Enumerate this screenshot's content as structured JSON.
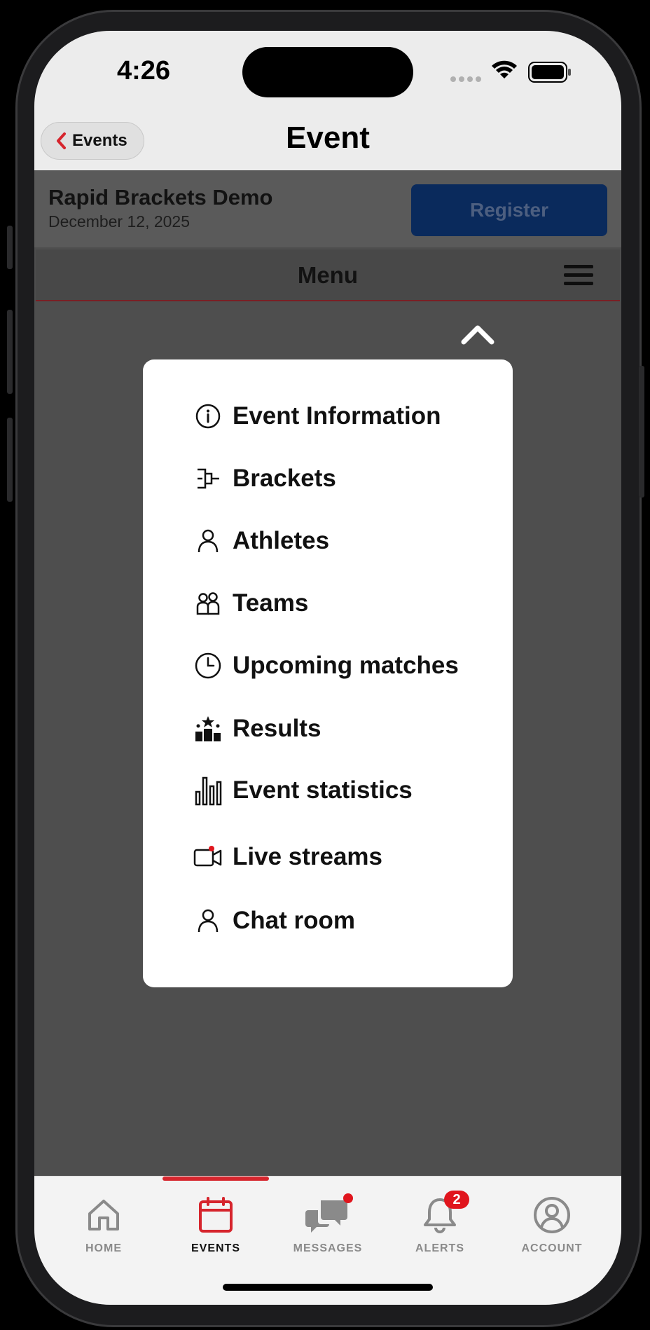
{
  "status_bar": {
    "time": "4:26"
  },
  "nav": {
    "back_label": "Events",
    "title": "Event"
  },
  "event": {
    "name": "Rapid Brackets Demo",
    "date": "December 12, 2025",
    "register_label": "Register",
    "menu_label": "Menu"
  },
  "popup_menu": {
    "items": [
      {
        "label": "Event Information",
        "icon": "info-icon"
      },
      {
        "label": "Brackets",
        "icon": "bracket-icon"
      },
      {
        "label": "Athletes",
        "icon": "person-icon"
      },
      {
        "label": "Teams",
        "icon": "team-icon"
      },
      {
        "label": "Upcoming matches",
        "icon": "clock-icon"
      },
      {
        "label": "Results",
        "icon": "podium-icon"
      },
      {
        "label": "Event statistics",
        "icon": "bar-chart-icon"
      },
      {
        "label": "Live streams",
        "icon": "video-camera-icon"
      },
      {
        "label": "Chat room",
        "icon": "person-icon"
      }
    ]
  },
  "tab_bar": {
    "active": "EVENTS",
    "tabs": [
      {
        "label": "HOME",
        "icon": "home-icon"
      },
      {
        "label": "EVENTS",
        "icon": "calendar-icon"
      },
      {
        "label": "MESSAGES",
        "icon": "chat-bubbles-icon"
      },
      {
        "label": "ALERTS",
        "icon": "bell-icon",
        "badge": "2"
      },
      {
        "label": "ACCOUNT",
        "icon": "account-icon"
      }
    ]
  },
  "colors": {
    "accent_red": "#d6252d",
    "register_blue": "#0a2a5c",
    "overlay_gray": "#4e4e4e"
  }
}
